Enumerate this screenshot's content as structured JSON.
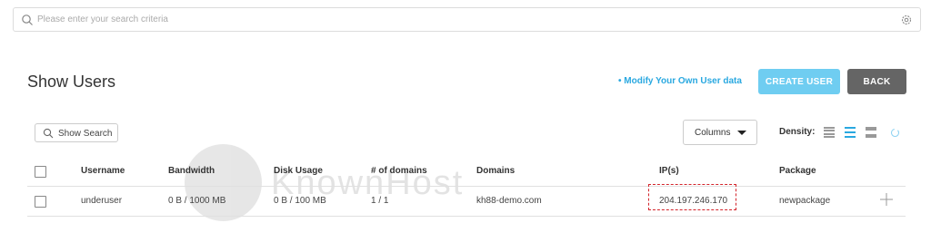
{
  "search": {
    "placeholder": "Please enter your search criteria"
  },
  "page": {
    "title": "Show Users"
  },
  "actions": {
    "modify_link": "• Modify Your Own User data",
    "create_user": "CREATE USER",
    "back": "BACK"
  },
  "toolbar": {
    "show_search": "Show Search",
    "columns": "Columns",
    "density_label": "Density:"
  },
  "table": {
    "headers": {
      "username": "Username",
      "bandwidth": "Bandwidth",
      "disk_usage": "Disk Usage",
      "num_domains": "# of domains",
      "domains": "Domains",
      "ips": "IP(s)",
      "package": "Package"
    },
    "rows": [
      {
        "username": "underuser",
        "bandwidth": "0 B / 1000 MB",
        "disk_usage": "0 B / 100 MB",
        "num_domains": "1 / 1",
        "domains": "kh88-demo.com",
        "ips": "204.197.246.170",
        "package": "newpackage"
      }
    ]
  },
  "watermark": {
    "text": "KnownHost"
  },
  "colors": {
    "accent": "#29a8e0",
    "create_button": "#6fcdf1",
    "back_button": "#656565",
    "highlight": "#d3242b"
  }
}
